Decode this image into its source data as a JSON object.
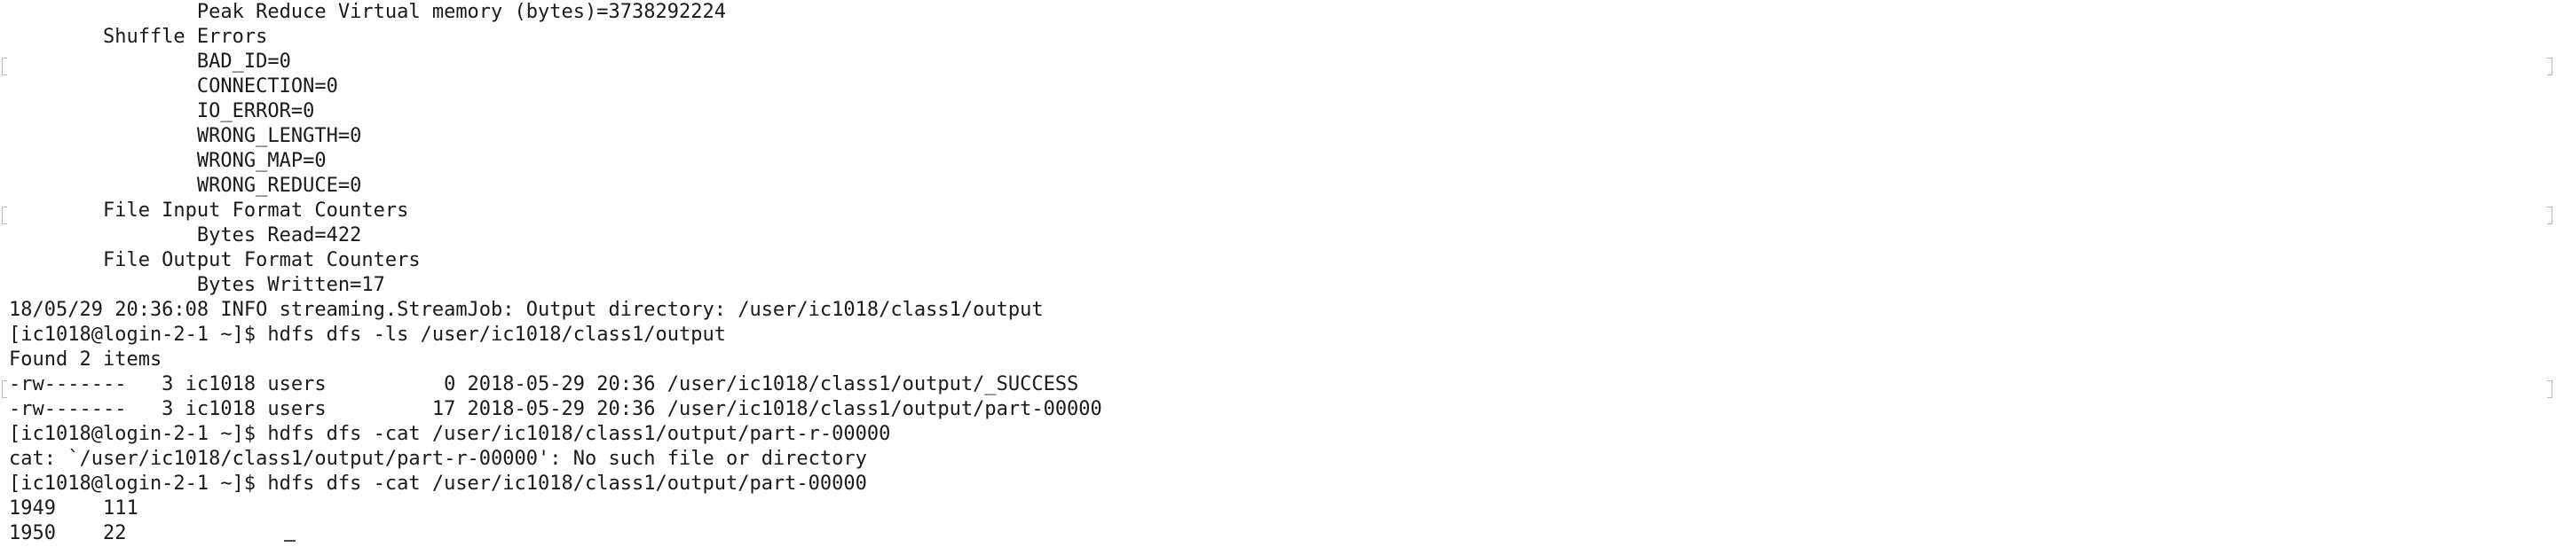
{
  "terminal": {
    "lines": [
      "                Peak Reduce Virtual memory (bytes)=3738292224",
      "        Shuffle Errors",
      "                BAD_ID=0",
      "                CONNECTION=0",
      "                IO_ERROR=0",
      "                WRONG_LENGTH=0",
      "                WRONG_MAP=0",
      "                WRONG_REDUCE=0",
      "        File Input Format Counters",
      "                Bytes Read=422",
      "        File Output Format Counters",
      "                Bytes Written=17",
      "18/05/29 20:36:08 INFO streaming.StreamJob: Output directory: /user/ic1018/class1/output",
      "[ic1018@login-2-1 ~]$ hdfs dfs -ls /user/ic1018/class1/output",
      "Found 2 items",
      "-rw-------   3 ic1018 users          0 2018-05-29 20:36 /user/ic1018/class1/output/_SUCCESS",
      "-rw-------   3 ic1018 users         17 2018-05-29 20:36 /user/ic1018/class1/output/part-00000",
      "[ic1018@login-2-1 ~]$ hdfs dfs -cat /user/ic1018/class1/output/part-r-00000",
      "cat: `/user/ic1018/class1/output/part-r-00000': No such file or directory",
      "[ic1018@login-2-1 ~]$ hdfs dfs -cat /user/ic1018/class1/output/part-00000",
      "1949    111",
      "1950    22"
    ]
  }
}
